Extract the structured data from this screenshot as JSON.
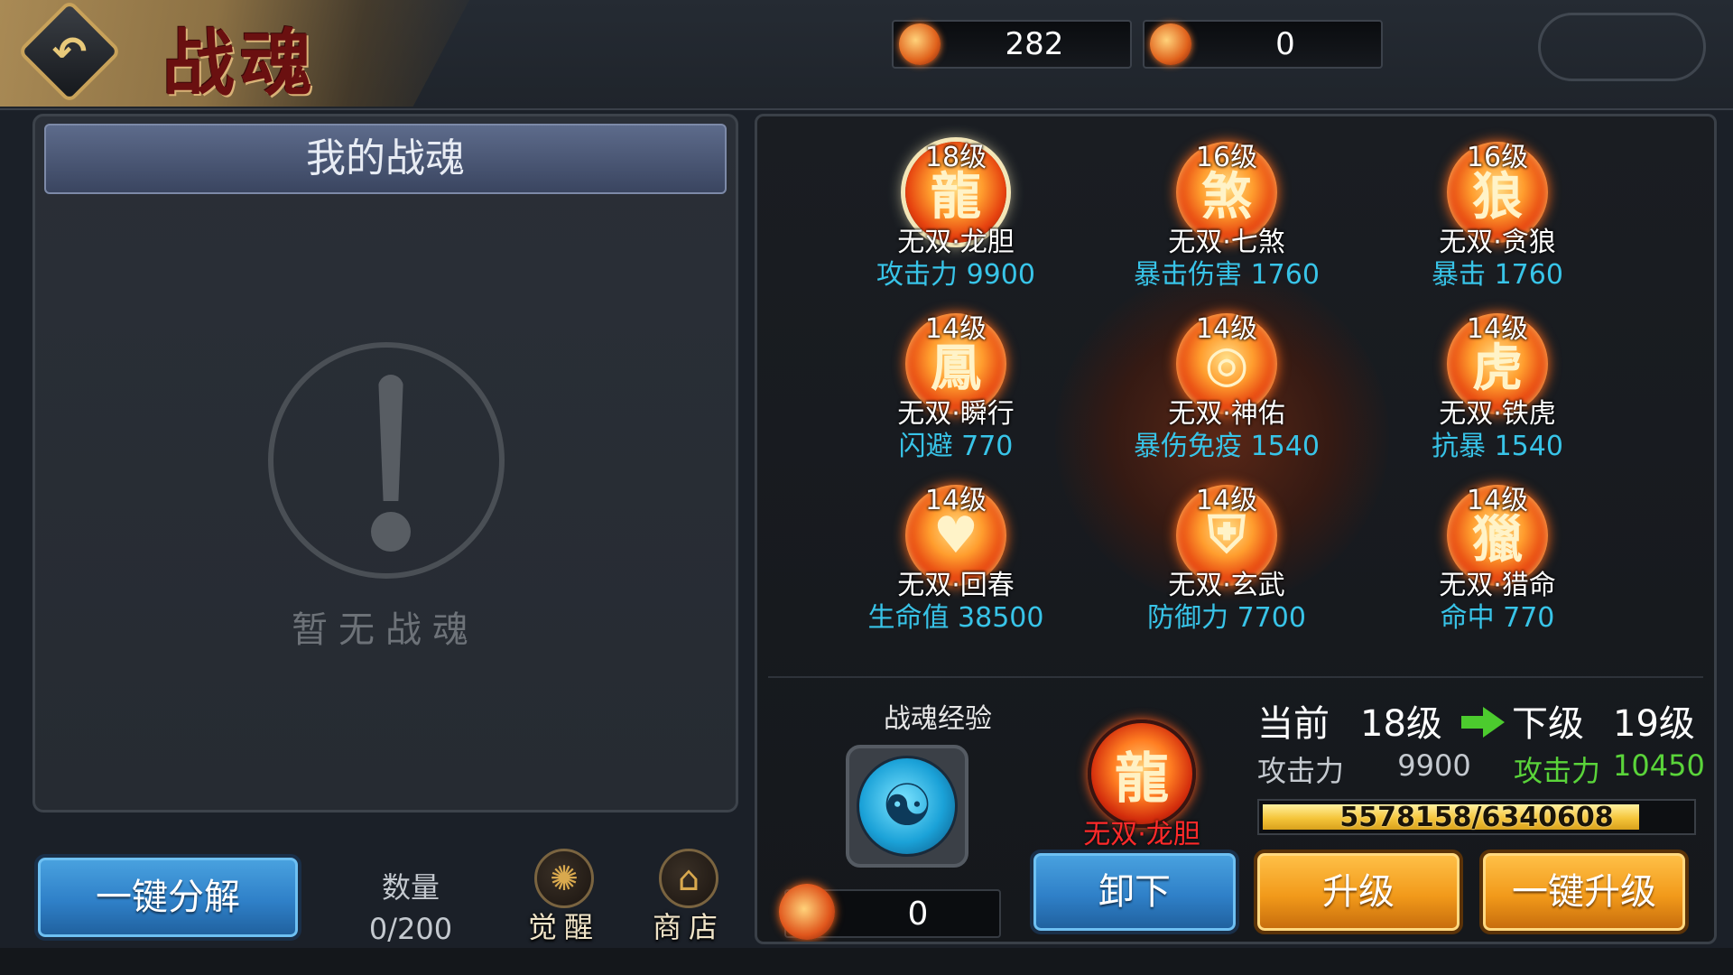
{
  "header": {
    "title": "战魂",
    "back_icon": "back-arrow-icon",
    "currencies": [
      {
        "icon": "soul-coin-icon",
        "value": "282"
      },
      {
        "icon": "flame-token-icon",
        "value": "0"
      }
    ]
  },
  "left_panel": {
    "title": "我的战魂",
    "empty_icon": "exclamation-icon",
    "empty_text": "暂无战魂"
  },
  "bottom_left": {
    "decompose_label": "一键分解",
    "quantity_label": "数量",
    "quantity_value": "0/200",
    "awaken_label": "觉醒",
    "awaken_icon": "awaken-swirl-icon",
    "shop_label": "商店",
    "shop_icon": "shop-icon"
  },
  "souls": [
    {
      "level": "18级",
      "name": "无双·龙胆",
      "stat": "攻击力 9900",
      "icon": "dragon-icon",
      "selected": true
    },
    {
      "level": "16级",
      "name": "无双·七煞",
      "stat": "暴击伤害 1760",
      "icon": "swirl-beast-icon",
      "selected": false
    },
    {
      "level": "16级",
      "name": "无双·贪狼",
      "stat": "暴击 1760",
      "icon": "wolf-icon",
      "selected": false
    },
    {
      "level": "14级",
      "name": "无双·瞬行",
      "stat": "闪避 770",
      "icon": "phoenix-icon",
      "selected": false
    },
    {
      "level": "14级",
      "name": "无双·神佑",
      "stat": "暴伤免疫 1540",
      "icon": "shield-ring-icon",
      "selected": false
    },
    {
      "level": "14级",
      "name": "无双·铁虎",
      "stat": "抗暴 1540",
      "icon": "tiger-icon",
      "selected": false
    },
    {
      "level": "14级",
      "name": "无双·回春",
      "stat": "生命值 38500",
      "icon": "heart-icon",
      "selected": false
    },
    {
      "level": "14级",
      "name": "无双·玄武",
      "stat": "防御力 7700",
      "icon": "turtle-shield-icon",
      "selected": false
    },
    {
      "level": "14级",
      "name": "无双·猎命",
      "stat": "命中 770",
      "icon": "hunter-icon",
      "selected": false
    }
  ],
  "detail": {
    "exp_label": "战魂经验",
    "exp_icon": "exp-orb-icon",
    "exp_counter_icon": "flame-token-icon",
    "exp_counter_value": "0",
    "selected_name": "无双·龙胆",
    "current_label": "当前",
    "current_level": "18级",
    "next_label": "下级",
    "next_level": "19级",
    "current_stat_name": "攻击力",
    "current_stat_value": "9900",
    "next_stat_name": "攻击力",
    "next_stat_value": "10450",
    "progress_text": "5578158/6340608",
    "progress_fraction": 0.8797,
    "unequip_label": "卸下",
    "upgrade_label": "升级",
    "upgrade_all_label": "一键升级"
  },
  "colors": {
    "stat_cyan": "#38c4e8",
    "next_green": "#5ad43a",
    "selected_name_red": "#ff2a2a",
    "button_blue": "#2f80c8",
    "button_orange": "#f29a1a"
  }
}
